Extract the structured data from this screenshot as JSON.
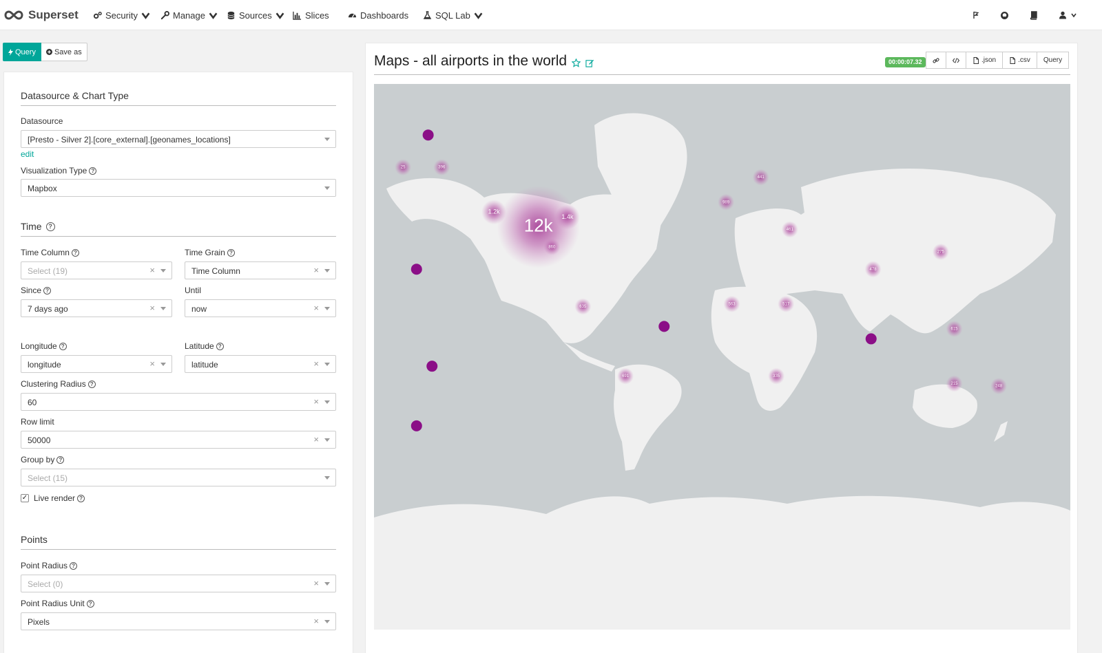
{
  "navbar": {
    "brand": "Superset",
    "items": [
      {
        "label": "Security",
        "icon": "cogs-icon",
        "dropdown": true
      },
      {
        "label": "Manage",
        "icon": "wrench-icon",
        "dropdown": true
      },
      {
        "label": "Sources",
        "icon": "database-icon",
        "dropdown": true
      },
      {
        "label": "Slices",
        "icon": "bar-chart-icon",
        "dropdown": false
      },
      {
        "label": "Dashboards",
        "icon": "dashboard-icon",
        "dropdown": false
      },
      {
        "label": "SQL Lab",
        "icon": "flask-icon",
        "dropdown": true
      }
    ],
    "right_icons": [
      "flag-icon",
      "github-icon",
      "book-icon",
      "user-icon"
    ]
  },
  "toolbar": {
    "query_label": "Query",
    "save_as_label": "Save as"
  },
  "controls": {
    "datasource_section": "Datasource & Chart Type",
    "datasource_label": "Datasource",
    "datasource_value": "[Presto - Silver 2].[core_external].[geonames_locations]",
    "edit_link": "edit",
    "viz_type_label": "Visualization Type",
    "viz_type_value": "Mapbox",
    "time_section": "Time",
    "time_column_label": "Time Column",
    "time_column_placeholder": "Select (19)",
    "time_grain_label": "Time Grain",
    "time_grain_value": "Time Column",
    "since_label": "Since",
    "since_value": "7 days ago",
    "until_label": "Until",
    "until_value": "now",
    "longitude_label": "Longitude",
    "longitude_value": "longitude",
    "latitude_label": "Latitude",
    "latitude_value": "latitude",
    "clustering_label": "Clustering Radius",
    "clustering_value": "60",
    "row_limit_label": "Row limit",
    "row_limit_value": "50000",
    "group_by_label": "Group by",
    "group_by_placeholder": "Select (15)",
    "live_render_label": "Live render",
    "live_render_checked": true,
    "points_section": "Points",
    "point_radius_label": "Point Radius",
    "point_radius_placeholder": "Select (0)",
    "point_radius_unit_label": "Point Radius Unit",
    "point_radius_unit_value": "Pixels"
  },
  "chart": {
    "title": "Maps - all airports in the world",
    "timer": "00:00:07.32",
    "buttons": {
      "json": ".json",
      "csv": ".csv",
      "query": "Query"
    },
    "clusters": [
      {
        "label": "12k",
        "lon": -95,
        "lat": 38
      },
      {
        "label": "1.4k",
        "lon": -80,
        "lat": 42
      },
      {
        "label": "1.2k",
        "lon": -118,
        "lat": 44
      },
      {
        "label": "860",
        "lon": -88,
        "lat": 30
      },
      {
        "label": "989",
        "lon": 2,
        "lat": 48
      },
      {
        "label": "396",
        "lon": -145,
        "lat": 62
      },
      {
        "label": "441",
        "lon": 20,
        "lat": 58
      },
      {
        "label": "461",
        "lon": 35,
        "lat": 37
      },
      {
        "label": "691",
        "lon": -50,
        "lat": -22
      },
      {
        "label": "615",
        "lon": 120,
        "lat": -3
      },
      {
        "label": "635",
        "lon": -72,
        "lat": 6
      },
      {
        "label": "563",
        "lon": 5,
        "lat": 7
      },
      {
        "label": "517",
        "lon": 33,
        "lat": 7
      },
      {
        "label": "478",
        "lon": 78,
        "lat": 21
      },
      {
        "label": "335",
        "lon": 28,
        "lat": -22
      },
      {
        "label": "275",
        "lon": 113,
        "lat": 28
      },
      {
        "label": "248",
        "lon": 143,
        "lat": -26
      },
      {
        "label": "215",
        "lon": 120,
        "lat": -25
      },
      {
        "label": "25",
        "lon": -165,
        "lat": 62
      }
    ],
    "points": [
      {
        "lon": -152,
        "lat": 75
      },
      {
        "lon": -158,
        "lat": 21
      },
      {
        "lon": -150,
        "lat": -18
      },
      {
        "lon": -158,
        "lat": -42
      },
      {
        "lon": -30,
        "lat": -2
      },
      {
        "lon": 77,
        "lat": -7
      }
    ]
  }
}
